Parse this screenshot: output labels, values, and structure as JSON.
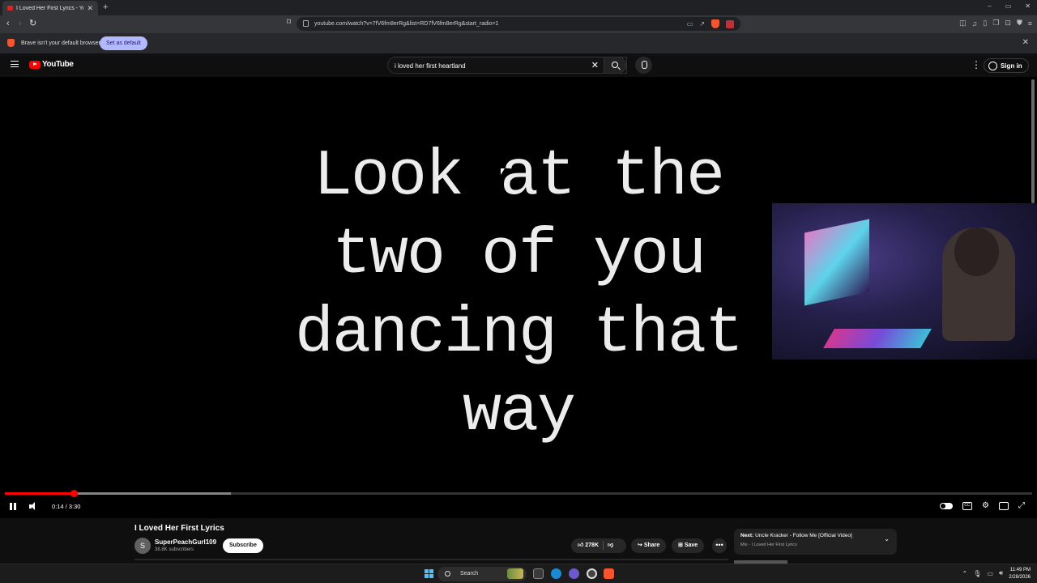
{
  "browser": {
    "tab_title": "I Loved Her First Lyrics - YouT",
    "tab_close": "✕",
    "new_tab": "+",
    "window_controls": [
      "–",
      "▭",
      "✕"
    ],
    "url": "youtube.com/watch?v=7fV6fm8erRg&list=RD7fV6fm8erRg&start_radio=1",
    "shield_badge": "2"
  },
  "infobar": {
    "message": "Brave isn't your default browser",
    "button": "Set as default",
    "close": "✕"
  },
  "youtube": {
    "logo_text": "YouTube",
    "search_value": "i loved her first heartland",
    "clear": "✕",
    "menu_dots": "⋮",
    "sign_in": "Sign in"
  },
  "video": {
    "lyrics": [
      "Look at the",
      "two of you",
      "dancing that",
      "way"
    ],
    "time": "0:14 / 3:30",
    "progress_fraction": 0.0667,
    "buffer_fraction": 0.22,
    "cc_label": "CC"
  },
  "details": {
    "title": "I Loved Her First Lyrics",
    "channel_initial": "S",
    "channel_name": "SuperPeachGurl109",
    "subscribers": "38.8K subscribers",
    "subscribe": "Subscribe",
    "likes": "278K",
    "share": "Share",
    "save": "Save",
    "more": "•••",
    "up_next_prefix": "Next:",
    "up_next_title": "Uncle Kracker - Follow Me [Official Video]",
    "up_next_mix": "Mix - I Loved Her First Lyrics",
    "chevron": "⌄"
  },
  "taskbar": {
    "search": "Search",
    "time": "11:49 PM",
    "date": "2/28/2026"
  },
  "colors": {
    "progress": "#ff0000",
    "brave_orange": "#fb542b",
    "set_default_bg": "#b3b8ff",
    "win_blue": "#4cc2ff"
  }
}
